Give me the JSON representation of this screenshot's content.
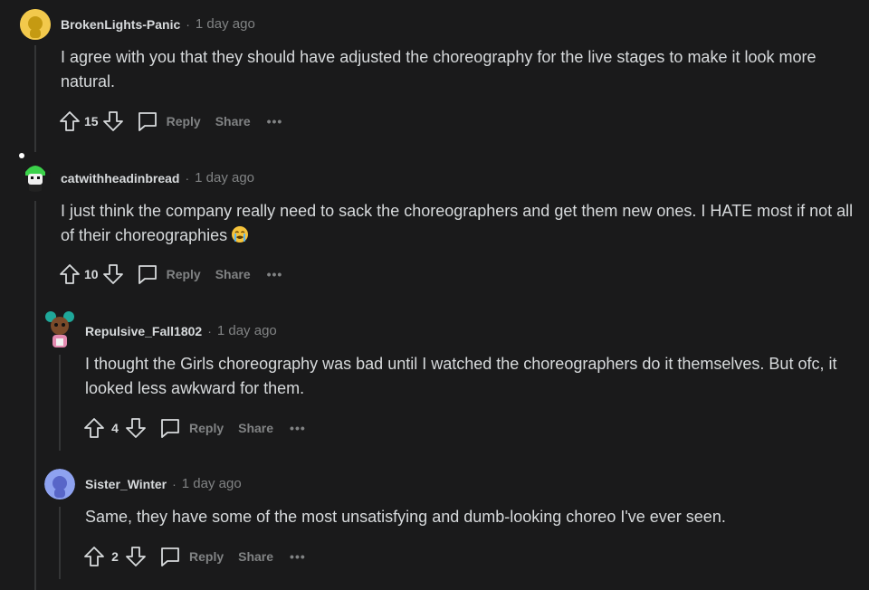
{
  "comments": [
    {
      "author": "BrokenLights-Panic",
      "time": "1 day ago",
      "body": "I agree with you that they should have adjusted the choreography for the live stages to make it look more natural.",
      "score": "15"
    },
    {
      "author": "catwithheadinbread",
      "time": "1 day ago",
      "body": "I just think the company really need to sack the choreographers and get them new ones. I HATE most if not all of their choreographies",
      "emoji": "loudly-crying-face-icon",
      "score": "10"
    },
    {
      "author": "Repulsive_Fall1802",
      "time": "1 day ago",
      "body": "I thought the Girls choreography was bad until I watched the choreographers do it themselves. But ofc, it looked less awkward for them.",
      "score": "4"
    },
    {
      "author": "Sister_Winter",
      "time": "1 day ago",
      "body": "Same, they have some of the most unsatisfying and dumb-looking choreo I've ever seen.",
      "score": "2"
    }
  ],
  "actions": {
    "reply_label": "Reply",
    "share_label": "Share",
    "more_label": "•••",
    "separator": "·"
  },
  "colors": {
    "background": "#1a1a1b",
    "text": "#d7dadc",
    "muted": "#818384",
    "thread_line": "#343536"
  }
}
